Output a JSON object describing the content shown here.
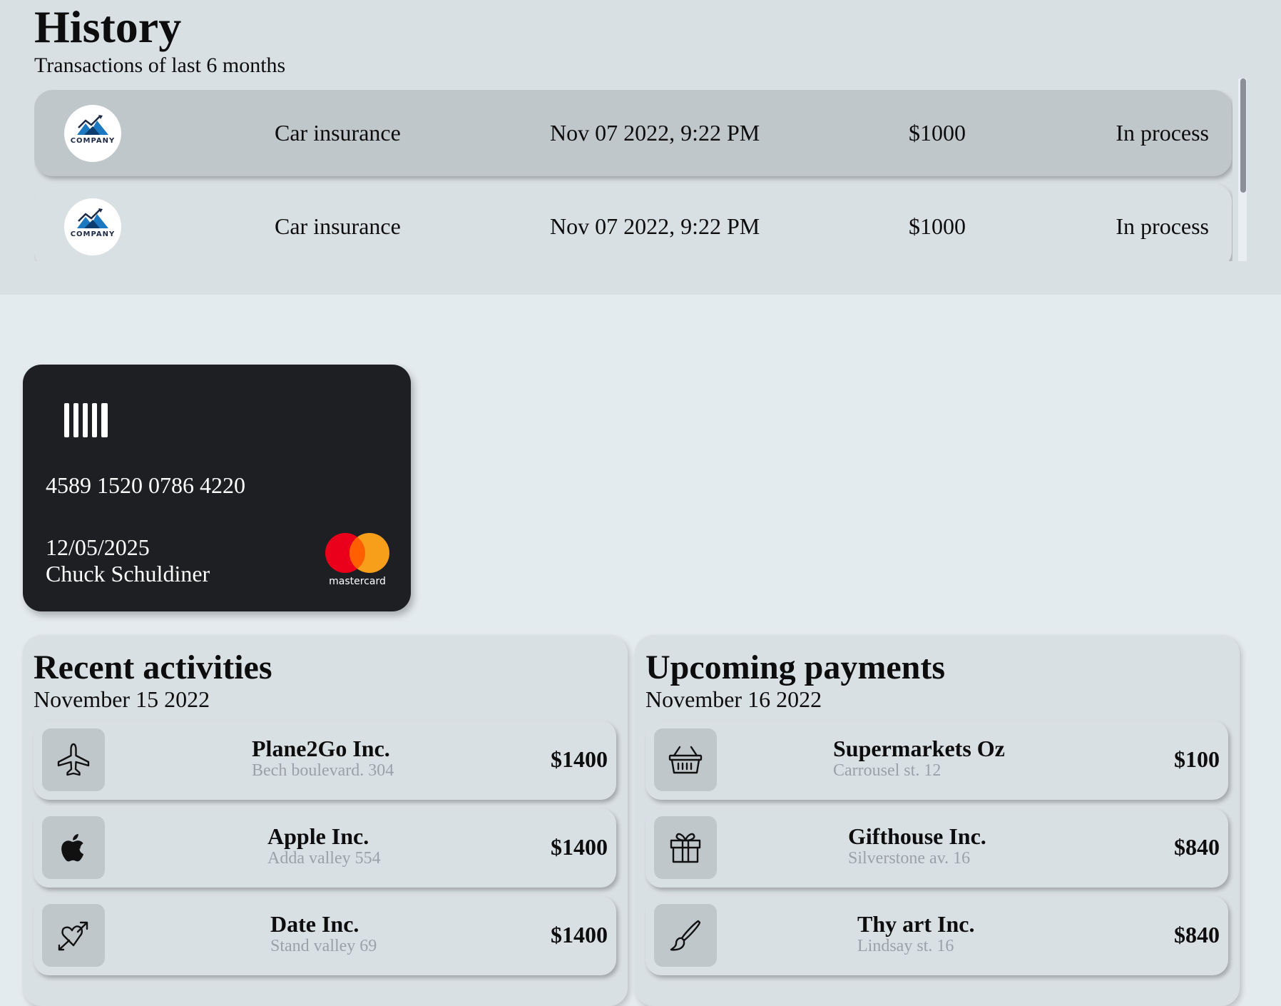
{
  "history": {
    "title": "History",
    "subtitle": "Transactions of last 6 months",
    "transactions": [
      {
        "logo_text": "COMPANY",
        "name": "Car insurance",
        "date": "Nov 07 2022, 9:22 PM",
        "amount": "$1000",
        "status": "In process"
      },
      {
        "logo_text": "COMPANY",
        "name": "Car insurance",
        "date": "Nov 07 2022, 9:22 PM",
        "amount": "$1000",
        "status": "In process"
      }
    ]
  },
  "card": {
    "number": "4589 1520 0786 4220",
    "expiry": "12/05/2025",
    "holder": "Chuck Schuldiner",
    "brand": "mastercard"
  },
  "recent": {
    "title": "Recent activities",
    "date": "November 15 2022",
    "items": [
      {
        "icon": "airplane-icon",
        "name": "Plane2Go Inc.",
        "address": "Bech boulevard. 304",
        "amount": "$1400"
      },
      {
        "icon": "apple-icon",
        "name": "Apple Inc.",
        "address": "Adda valley 554",
        "amount": "$1400"
      },
      {
        "icon": "heart-arrow-icon",
        "name": "Date Inc.",
        "address": "Stand valley 69",
        "amount": "$1400"
      }
    ]
  },
  "upcoming": {
    "title": "Upcoming payments",
    "date": "November 16 2022",
    "items": [
      {
        "icon": "basket-icon",
        "name": "Supermarkets Oz",
        "address": "Carrousel st. 12",
        "amount": "$100"
      },
      {
        "icon": "gift-icon",
        "name": "Gifthouse Inc.",
        "address": "Silverstone av. 16",
        "amount": "$840"
      },
      {
        "icon": "brush-icon",
        "name": "Thy art Inc.",
        "address": "Lindsay st. 16",
        "amount": "$840"
      }
    ]
  },
  "colors": {
    "page_bg": "#e4ebee",
    "history_bg": "#d9e0e4",
    "highlight_row": "#c0c7cb",
    "card_bg": "#1d1f22",
    "address_gray": "#9aa2a8"
  }
}
